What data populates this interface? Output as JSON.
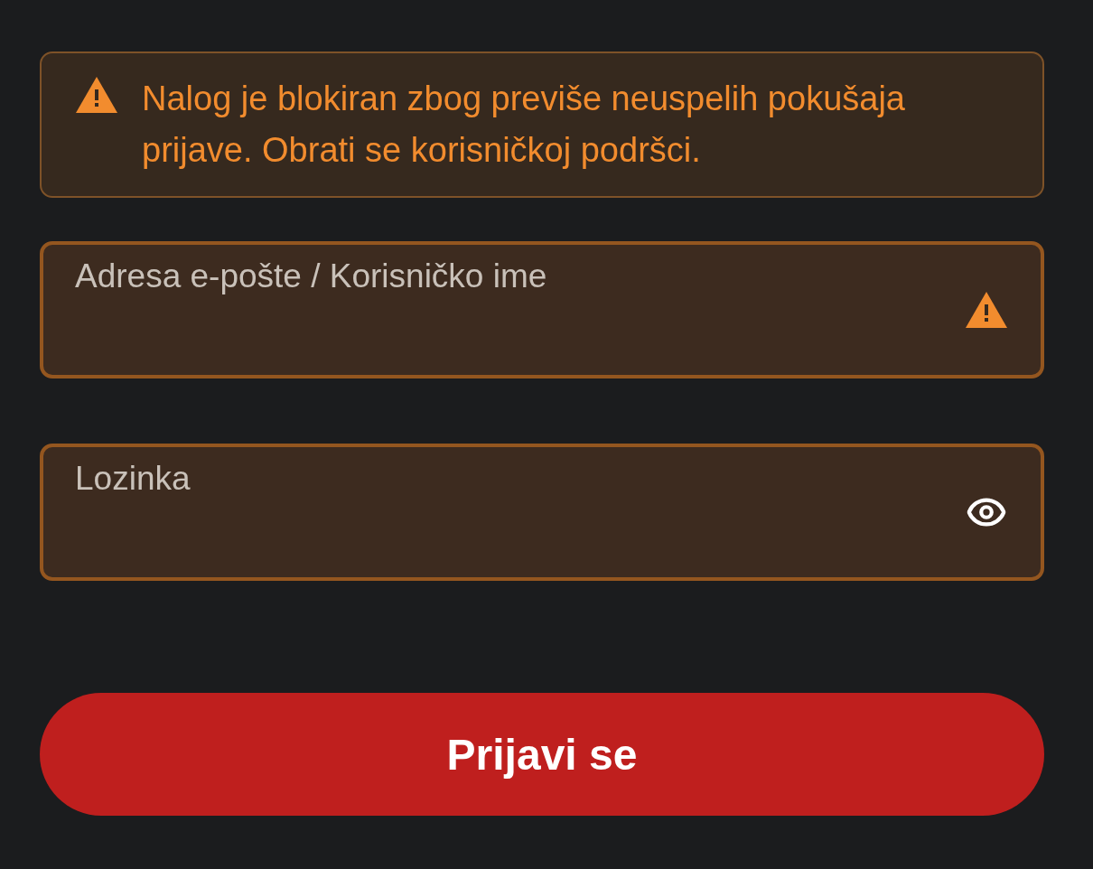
{
  "alert": {
    "kind": "warning",
    "message": "Nalog je blokiran zbog previše neuspelih pokušaja prijave. Obrati se korisničkoj podršci."
  },
  "fields": [
    {
      "kind": "text",
      "placeholder": "Adresa e-pošte / Korisničko ime",
      "invalid": true
    },
    {
      "kind": "password",
      "placeholder": "Lozinka",
      "invalid": true
    }
  ],
  "submit_button": {
    "label": "Prijavi se"
  }
}
